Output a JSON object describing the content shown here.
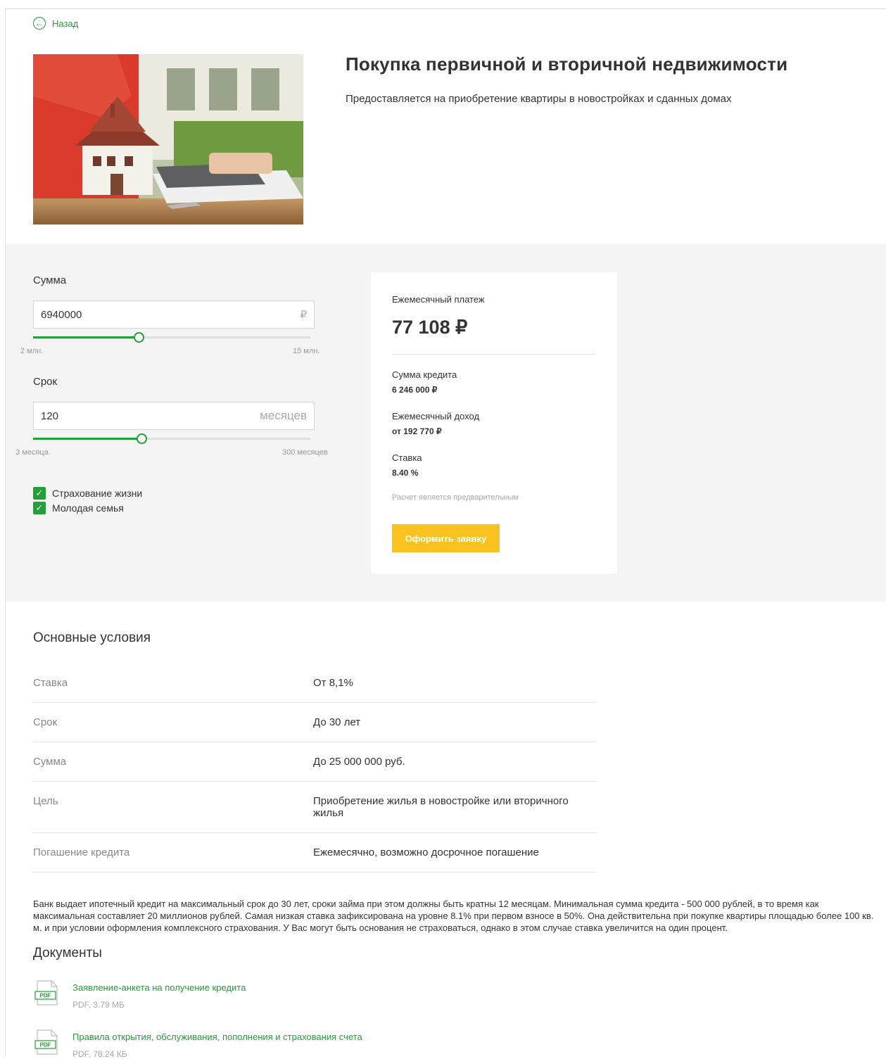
{
  "nav": {
    "back_label": "Назад"
  },
  "header": {
    "title": "Покупка первичной и вторичной недвижимости",
    "subtitle": "Предоставляется на приобретение квартиры в новостройках и сданных домах"
  },
  "calculator": {
    "amount": {
      "label": "Сумма",
      "value": "6940000",
      "unit": "₽",
      "min_label": "2 млн.",
      "max_label": "15 млн.",
      "slider_fraction": 0.38
    },
    "term": {
      "label": "Срок",
      "value": "120",
      "unit": "месяцев",
      "min_label": "3 месяца",
      "max_label": "300 месяцев",
      "slider_fraction": 0.39
    },
    "options": [
      {
        "label": "Страхование жизни",
        "checked": true
      },
      {
        "label": "Молодая семья",
        "checked": true
      }
    ]
  },
  "result": {
    "monthly_label": "Ежемесячный платеж",
    "monthly_value": "77 108 ₽",
    "credit_label": "Сумма кредита",
    "credit_value": "6 246 000 ₽",
    "income_label": "Ежемесячный доход",
    "income_value": "от 192 770 ₽",
    "rate_label": "Ставка",
    "rate_value": "8.40 %",
    "note": "Расчет является предварительным",
    "apply_label": "Оформить заявку"
  },
  "conditions": {
    "title": "Основные условия",
    "rows": [
      {
        "key": "Ставка",
        "value": "От 8,1%"
      },
      {
        "key": "Срок",
        "value": "До 30 лет"
      },
      {
        "key": "Сумма",
        "value": "До 25 000 000 руб."
      },
      {
        "key": "Цель",
        "value": "Приобретение жилья в новостройке или вторичного жилья"
      },
      {
        "key": "Погашение кредита",
        "value": "Ежемесячно, возможно досрочное погашение"
      }
    ]
  },
  "description": "Банк выдает ипотечный кредит на максимальный срок до 30 лет, сроки займа при этом должны быть кратны 12 месяцам. Минимальная сумма кредита - 500 000 рублей, в то время как максимальная составляет 20 миллионов рублей. Самая низкая ставка зафиксирована на уровне 8.1% при первом взносе в 50%. Она действительна при покупке квартиры площадью более 100 кв. м. и при условии оформления комплексного страхования. У Вас могут быть основания не страховаться, однако в этом случае ставка увеличится на один процент.",
  "documents": {
    "title": "Документы",
    "items": [
      {
        "name": "Заявление-анкета на получение кредита",
        "meta": "PDF, 3.79 МБ"
      },
      {
        "name": "Правила открытия, обслуживания, пополнения и страхования счета",
        "meta": "PDF, 78.24 КБ"
      }
    ]
  },
  "colors": {
    "accent": "#21a038",
    "button": "#f9c21f",
    "panel": "#f4f4f4"
  }
}
